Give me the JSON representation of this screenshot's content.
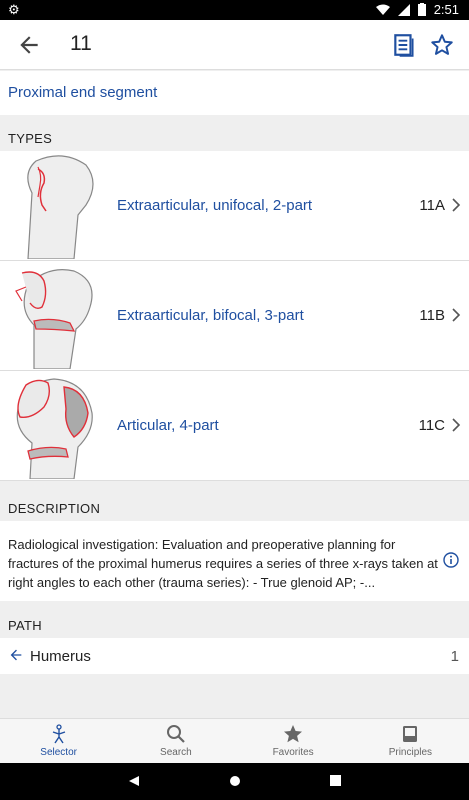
{
  "status_bar": {
    "time": "2:51"
  },
  "app_bar": {
    "title": "11"
  },
  "section_link": {
    "label": "Proximal end segment"
  },
  "types": {
    "header": "TYPES",
    "items": [
      {
        "label": "Extraarticular, unifocal, 2-part",
        "code": "11A"
      },
      {
        "label": "Extraarticular, bifocal, 3-part",
        "code": "11B"
      },
      {
        "label": "Articular, 4-part",
        "code": "11C"
      }
    ]
  },
  "description": {
    "header": "DESCRIPTION",
    "text": "Radiological investigation: Evaluation and preoperative planning for fractures of the proximal humerus requires a series of three x-rays taken at right angles to each other (trauma series):   - True glenoid AP; -..."
  },
  "path": {
    "header": "PATH",
    "item_label": "Humerus",
    "item_count": "1"
  },
  "bottom_nav": {
    "tabs": [
      {
        "label": "Selector",
        "icon": "selector-icon",
        "active": true
      },
      {
        "label": "Search",
        "icon": "search-icon",
        "active": false
      },
      {
        "label": "Favorites",
        "icon": "star-icon",
        "active": false
      },
      {
        "label": "Principles",
        "icon": "book-icon",
        "active": false
      }
    ]
  },
  "colors": {
    "accent": "#1f4fa0",
    "fracture_line": "#e0303a",
    "bone_fill": "#eeeeee"
  }
}
